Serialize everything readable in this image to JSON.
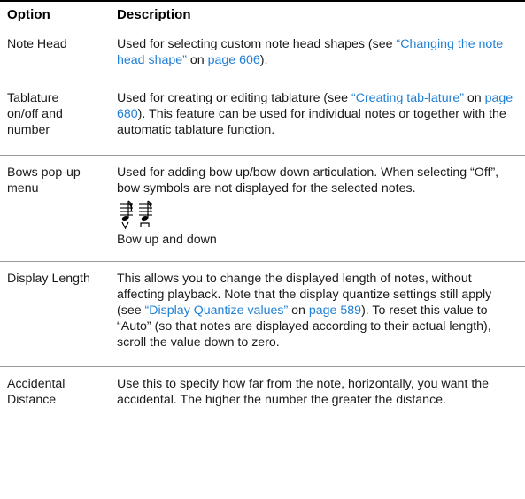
{
  "header": {
    "option": "Option",
    "description": "Description"
  },
  "rows": [
    {
      "option": "Note Head",
      "desc_pre": "Used for selecting custom note head shapes (see ",
      "link1": "“Changing the note head shape”",
      "mid1": " on ",
      "link2": "page 606",
      "desc_post": ")."
    },
    {
      "option": "Tablature on/off and number",
      "desc_pre": "Used for creating or editing tablature (see ",
      "link1": "“Creating tab-lature”",
      "mid1": " on ",
      "link2": "page 680",
      "desc_post": "). This feature can be used for individual notes or together with the automatic tablature function."
    },
    {
      "option": "Bows pop-up menu",
      "desc": "Used for adding bow up/bow down articulation. When selecting “Off”, bow symbols are not displayed for the selected notes.",
      "caption": "Bow up and down"
    },
    {
      "option": "Display Length",
      "desc_pre": "This allows you to change the displayed length of notes, without affecting playback. Note that the display quantize settings still apply (see ",
      "link1": "“Display Quantize values”",
      "mid1": " on ",
      "link2": "page 589",
      "desc_post": "). To reset this value to “Auto” (so that notes are displayed according to their actual length), scroll the value down to zero."
    },
    {
      "option": "Accidental Distance",
      "desc": "Use this to specify how far from the note, horizontally, you want the accidental. The higher the number the greater the distance."
    }
  ]
}
